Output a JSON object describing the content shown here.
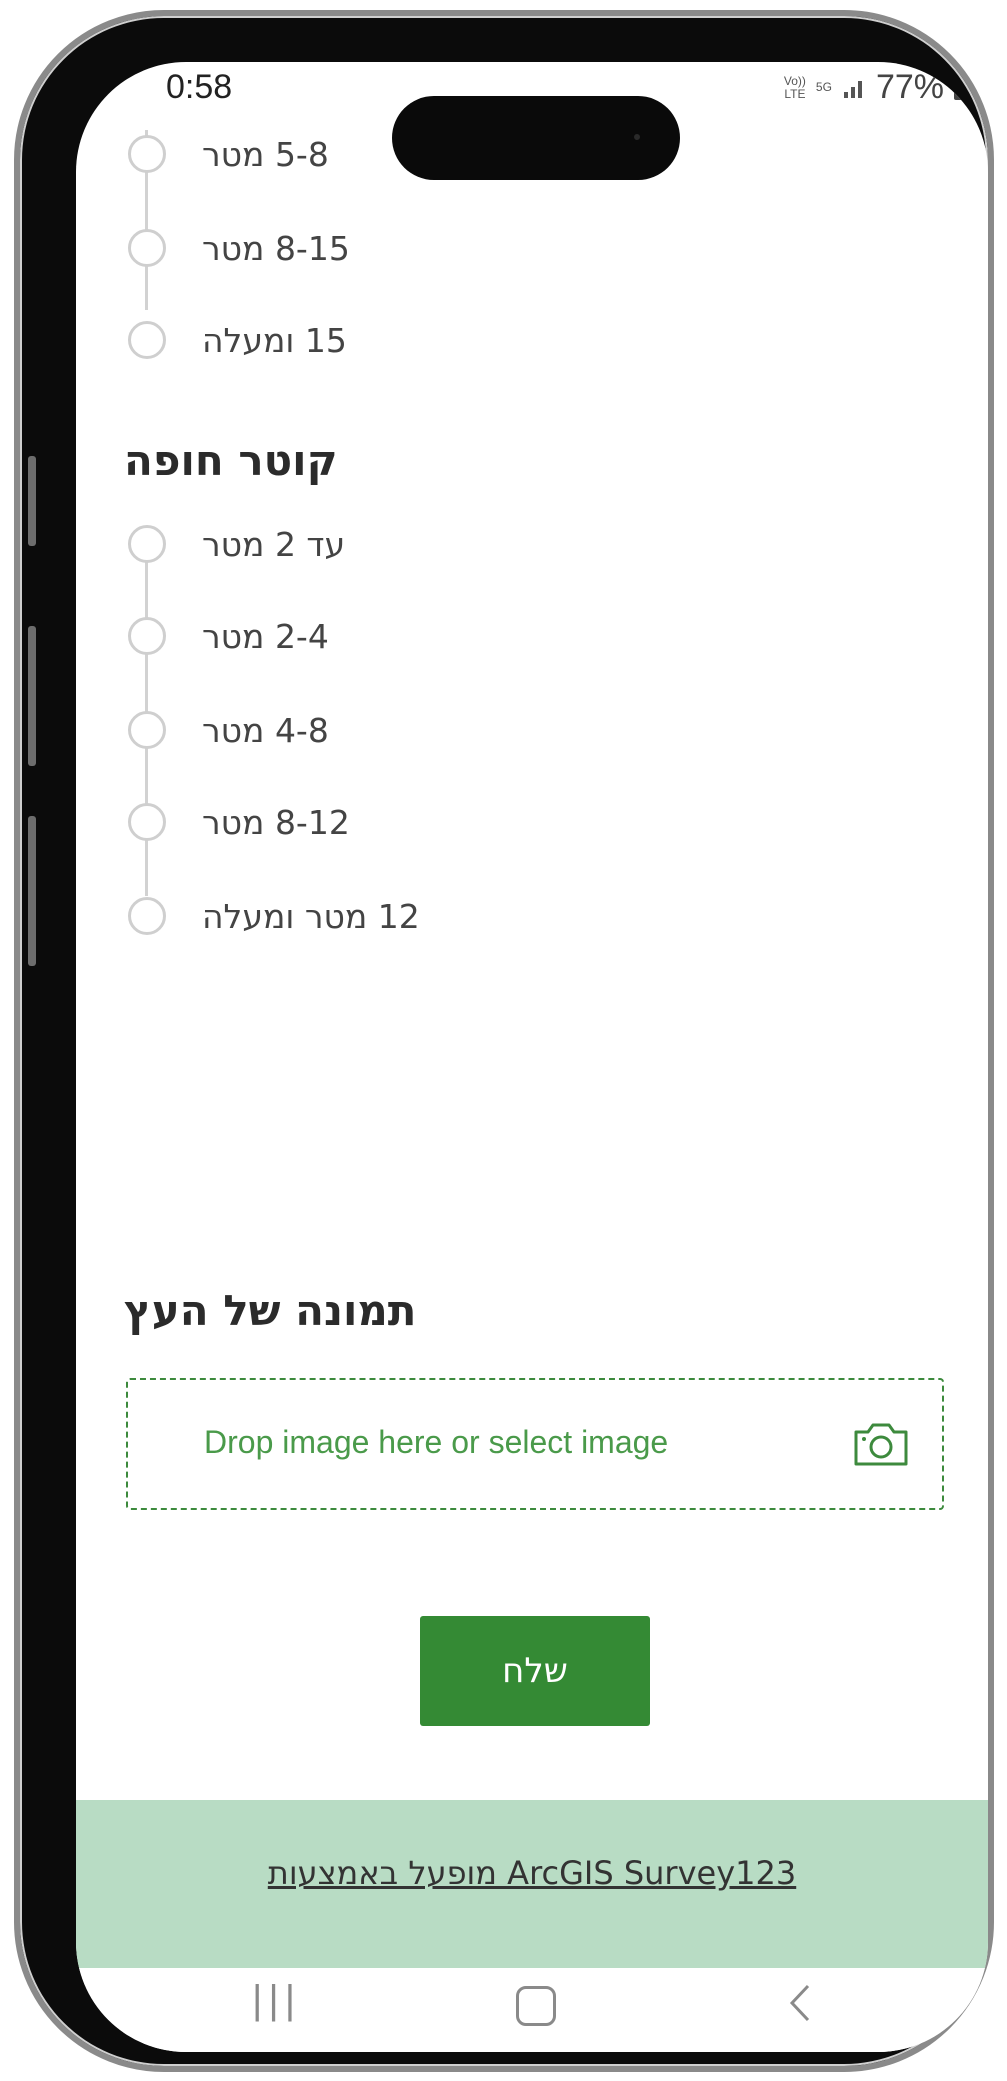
{
  "status_bar": {
    "time": "0:58",
    "network_top": "Vo))",
    "network_bottom": "LTE",
    "signal_label": "5G",
    "battery": "77%"
  },
  "tree_height_options": [
    {
      "label": "5-8 מטר"
    },
    {
      "label": "8-15 מטר"
    },
    {
      "label": "15 ומעלה"
    }
  ],
  "canopy_section": {
    "title": "קוטר חופה",
    "options": [
      {
        "label": "עד 2 מטר"
      },
      {
        "label": "2-4 מטר"
      },
      {
        "label": "4-8 מטר"
      },
      {
        "label": "8-12 מטר"
      },
      {
        "label": "12 מטר ומעלה"
      }
    ]
  },
  "photo_section": {
    "title": "תמונה של העץ",
    "dropzone_text": "Drop image here or select image",
    "icon": "camera-icon"
  },
  "submit": {
    "label": "שלח"
  },
  "footer": {
    "text": "מופעל באמצעות ArcGIS Survey123"
  },
  "nav_bar": {
    "recent_icon": "|||",
    "back_icon": "chevron-left-icon",
    "home_icon": "home-square-icon"
  },
  "colors": {
    "accent": "#348a34",
    "footer_bg": "#b8dcc4",
    "dropzone_text": "#4a9a4a",
    "radio_border": "#cfcfcf"
  }
}
